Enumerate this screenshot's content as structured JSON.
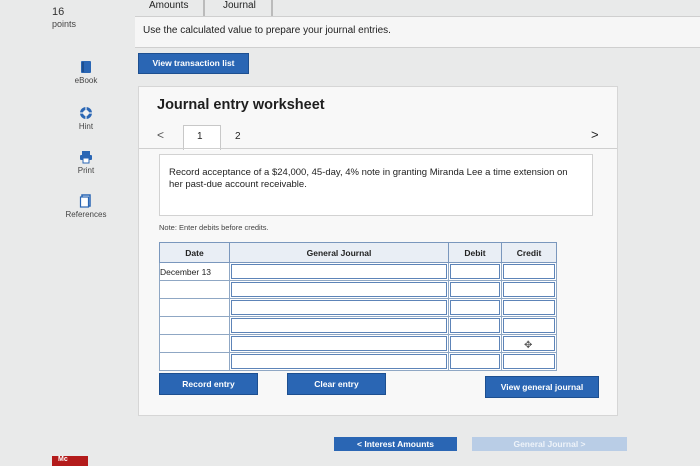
{
  "question": {
    "number": "16",
    "points_label": "points"
  },
  "rail": [
    {
      "label": "eBook",
      "icon": "book-icon"
    },
    {
      "label": "Hint",
      "icon": "lifebuoy-icon"
    },
    {
      "label": "Print",
      "icon": "printer-icon"
    },
    {
      "label": "References",
      "icon": "document-icon"
    }
  ],
  "brand_badge": "Mc",
  "top_tabs": {
    "amounts": "Amounts",
    "journal": "Journal"
  },
  "instructions": "Use the calculated value to prepare your journal entries.",
  "view_transaction_list": "View transaction list",
  "worksheet": {
    "title": "Journal entry worksheet",
    "prev": "<",
    "next": ">",
    "tabs": [
      "1",
      "2"
    ],
    "prompt": "Record acceptance of a $24,000, 45-day, 4% note in granting Miranda Lee a time extension on her past-due account receivable.",
    "note": "Note: Enter debits before credits.",
    "columns": {
      "date": "Date",
      "account": "General Journal",
      "debit": "Debit",
      "credit": "Credit"
    },
    "rows": [
      {
        "date": "December 13",
        "account": "",
        "debit": "",
        "credit": ""
      },
      {
        "date": "",
        "account": "",
        "debit": "",
        "credit": ""
      },
      {
        "date": "",
        "account": "",
        "debit": "",
        "credit": ""
      },
      {
        "date": "",
        "account": "",
        "debit": "",
        "credit": ""
      },
      {
        "date": "",
        "account": "",
        "debit": "",
        "credit": ""
      },
      {
        "date": "",
        "account": "",
        "debit": "",
        "credit": ""
      }
    ],
    "record_entry": "Record entry",
    "clear_entry": "Clear entry",
    "view_general_journal": "View general journal"
  },
  "bottom_nav": {
    "prev": "< Interest Amounts",
    "next": "General Journal >"
  },
  "colors": {
    "accent": "#2a66b4",
    "table_border": "#8fa7c4"
  }
}
